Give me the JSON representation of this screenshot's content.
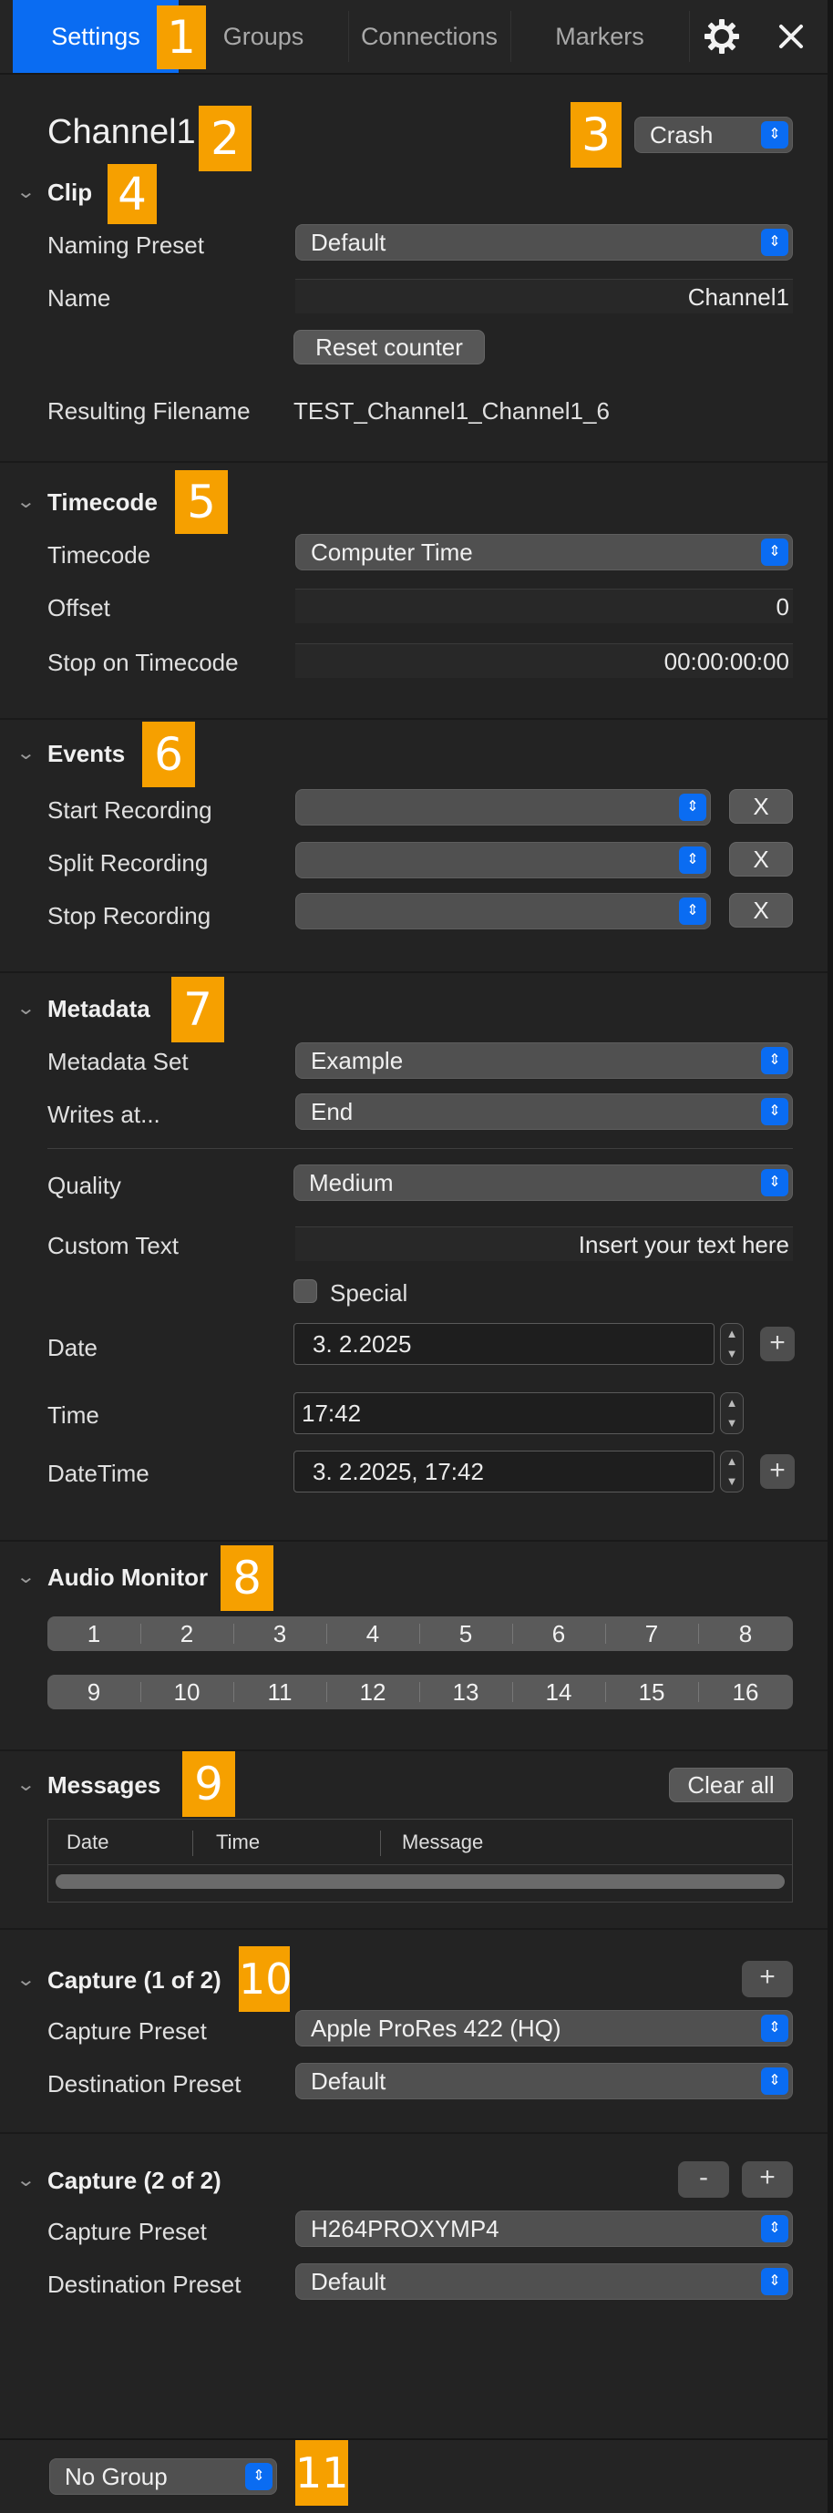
{
  "tabs": [
    "Settings",
    "Groups",
    "Connections",
    "Markers"
  ],
  "icons": {
    "settings": "gear-icon",
    "close": "close-icon"
  },
  "channel": {
    "title": "Channel1",
    "mode": "Crash"
  },
  "clip": {
    "title": "Clip",
    "naming_preset_label": "Naming Preset",
    "naming_preset": "Default",
    "name_label": "Name",
    "name_value": "Channel1",
    "reset_button": "Reset counter",
    "resulting_label": "Resulting Filename",
    "resulting_value": "TEST_Channel1_Channel1_6"
  },
  "timecode": {
    "title": "Timecode",
    "timecode_label": "Timecode",
    "timecode_value": "Computer Time",
    "offset_label": "Offset",
    "offset_value": "0",
    "stop_label": "Stop on Timecode",
    "stop_value": "00:00:00:00"
  },
  "events": {
    "title": "Events",
    "rows": [
      {
        "label": "Start Recording",
        "value": "",
        "clear": "X"
      },
      {
        "label": "Split Recording",
        "value": "",
        "clear": "X"
      },
      {
        "label": "Stop Recording",
        "value": "",
        "clear": "X"
      }
    ]
  },
  "metadata": {
    "title": "Metadata",
    "set_label": "Metadata Set",
    "set_value": "Example",
    "writes_label": "Writes at...",
    "writes_value": "End",
    "quality_label": "Quality",
    "quality_value": "Medium",
    "custom_label": "Custom Text",
    "custom_value": "Insert your text here",
    "special_label": "Special",
    "special_checked": false,
    "date_label": "Date",
    "date_value": "3.  2.2025",
    "time_label": "Time",
    "time_value": "17:42",
    "datetime_label": "DateTime",
    "datetime_value": "3.  2.2025,  17:42",
    "plus": "+"
  },
  "audio": {
    "title": "Audio Monitor",
    "row1": [
      "1",
      "2",
      "3",
      "4",
      "5",
      "6",
      "7",
      "8"
    ],
    "row2": [
      "9",
      "10",
      "11",
      "12",
      "13",
      "14",
      "15",
      "16"
    ]
  },
  "messages": {
    "title": "Messages",
    "clear_all": "Clear all",
    "columns": [
      "Date",
      "Time",
      "Message"
    ]
  },
  "capture1": {
    "title": "Capture (1 of 2)",
    "add": "+",
    "capture_label": "Capture Preset",
    "capture_value": "Apple ProRes 422 (HQ)",
    "dest_label": "Destination Preset",
    "dest_value": "Default"
  },
  "capture2": {
    "title": "Capture (2 of 2)",
    "remove": "-",
    "add": "+",
    "capture_label": "Capture Preset",
    "capture_value": "H264PROXYMP4",
    "dest_label": "Destination Preset",
    "dest_value": "Default"
  },
  "footer": {
    "group": "No Group"
  },
  "annotations": [
    "1",
    "2",
    "3",
    "4",
    "5",
    "6",
    "7",
    "8",
    "9",
    "10",
    "11"
  ],
  "colors": {
    "accent": "#0a6cf2",
    "annotation": "#f6a000",
    "panel": "#232323"
  }
}
